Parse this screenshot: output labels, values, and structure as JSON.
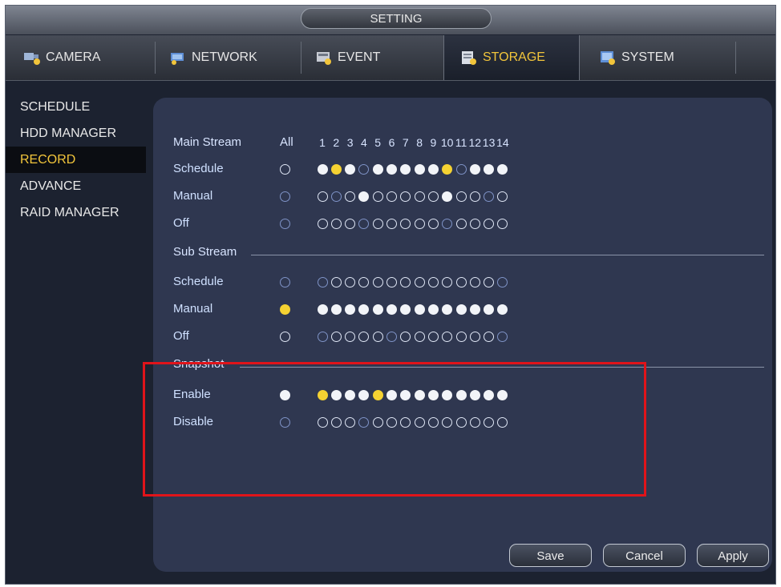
{
  "window_title": "SETTING",
  "tabs": [
    {
      "label": "CAMERA",
      "icon": "camera-icon",
      "active": false
    },
    {
      "label": "NETWORK",
      "icon": "network-icon",
      "active": false
    },
    {
      "label": "EVENT",
      "icon": "event-icon",
      "active": false
    },
    {
      "label": "STORAGE",
      "icon": "storage-icon",
      "active": true
    },
    {
      "label": "SYSTEM",
      "icon": "system-icon",
      "active": false
    }
  ],
  "sidebar": {
    "items": [
      {
        "label": "SCHEDULE",
        "active": false
      },
      {
        "label": "HDD MANAGER",
        "active": false
      },
      {
        "label": "RECORD",
        "active": true
      },
      {
        "label": "ADVANCE",
        "active": false
      },
      {
        "label": "RAID MANAGER",
        "active": false
      }
    ]
  },
  "grid": {
    "header_label": "Main Stream",
    "all_label": "All",
    "channels": [
      "1",
      "2",
      "3",
      "4",
      "5",
      "6",
      "7",
      "8",
      "9",
      "10",
      "11",
      "12",
      "13",
      "14"
    ],
    "main_rows": [
      {
        "label": "Schedule",
        "all": "empty",
        "states": [
          "full",
          "sel",
          "full",
          "empty-dim",
          "full",
          "full",
          "full",
          "full",
          "full",
          "sel",
          "empty-dim",
          "full",
          "full",
          "full"
        ]
      },
      {
        "label": "Manual",
        "all": "empty-dim",
        "states": [
          "empty",
          "empty-dim",
          "empty",
          "full",
          "empty",
          "empty",
          "empty",
          "empty",
          "empty",
          "full",
          "empty",
          "empty",
          "empty-dim",
          "empty"
        ]
      },
      {
        "label": "Off",
        "all": "empty-dim",
        "states": [
          "empty",
          "empty",
          "empty",
          "empty-dim",
          "empty",
          "empty",
          "empty",
          "empty",
          "empty",
          "empty-dim",
          "empty",
          "empty",
          "empty",
          "empty"
        ]
      }
    ],
    "sub_section_label": "Sub Stream",
    "sub_rows": [
      {
        "label": "Schedule",
        "all": "empty-dim",
        "states": [
          "empty-dim",
          "empty",
          "empty",
          "empty",
          "empty",
          "empty",
          "empty",
          "empty",
          "empty",
          "empty",
          "empty",
          "empty",
          "empty",
          "empty-dim"
        ]
      },
      {
        "label": "Manual",
        "all": "sel",
        "states": [
          "full",
          "full",
          "full",
          "full",
          "full",
          "full",
          "full",
          "full",
          "full",
          "full",
          "full",
          "full",
          "full",
          "full"
        ]
      },
      {
        "label": "Off",
        "all": "empty",
        "states": [
          "empty-dim",
          "empty",
          "empty",
          "empty",
          "empty",
          "empty-dim",
          "empty",
          "empty",
          "empty",
          "empty",
          "empty",
          "empty",
          "empty",
          "empty-dim"
        ]
      }
    ],
    "snapshot_section_label": "Snapshot",
    "snapshot_rows": [
      {
        "label": "Enable",
        "all": "full",
        "states": [
          "sel",
          "full",
          "full",
          "full",
          "sel",
          "full",
          "full",
          "full",
          "full",
          "full",
          "full",
          "full",
          "full",
          "full"
        ]
      },
      {
        "label": "Disable",
        "all": "empty-dim",
        "states": [
          "empty",
          "empty",
          "empty",
          "empty-dim",
          "empty",
          "empty",
          "empty",
          "empty",
          "empty",
          "empty",
          "empty",
          "empty",
          "empty",
          "empty"
        ]
      }
    ]
  },
  "buttons": {
    "save": "Save",
    "cancel": "Cancel",
    "apply": "Apply"
  },
  "colors": {
    "accent": "#f2c53b",
    "highlight_box": "#e0141a",
    "panel": "#2f3750"
  }
}
